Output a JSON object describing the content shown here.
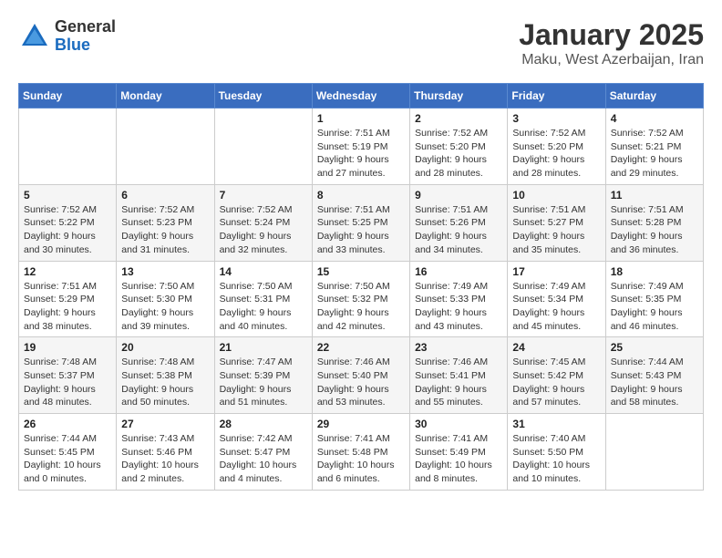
{
  "header": {
    "logo_general": "General",
    "logo_blue": "Blue",
    "title": "January 2025",
    "subtitle": "Maku, West Azerbaijan, Iran"
  },
  "weekdays": [
    "Sunday",
    "Monday",
    "Tuesday",
    "Wednesday",
    "Thursday",
    "Friday",
    "Saturday"
  ],
  "weeks": [
    [
      {
        "day": "",
        "detail": ""
      },
      {
        "day": "",
        "detail": ""
      },
      {
        "day": "",
        "detail": ""
      },
      {
        "day": "1",
        "detail": "Sunrise: 7:51 AM\nSunset: 5:19 PM\nDaylight: 9 hours\nand 27 minutes."
      },
      {
        "day": "2",
        "detail": "Sunrise: 7:52 AM\nSunset: 5:20 PM\nDaylight: 9 hours\nand 28 minutes."
      },
      {
        "day": "3",
        "detail": "Sunrise: 7:52 AM\nSunset: 5:20 PM\nDaylight: 9 hours\nand 28 minutes."
      },
      {
        "day": "4",
        "detail": "Sunrise: 7:52 AM\nSunset: 5:21 PM\nDaylight: 9 hours\nand 29 minutes."
      }
    ],
    [
      {
        "day": "5",
        "detail": "Sunrise: 7:52 AM\nSunset: 5:22 PM\nDaylight: 9 hours\nand 30 minutes."
      },
      {
        "day": "6",
        "detail": "Sunrise: 7:52 AM\nSunset: 5:23 PM\nDaylight: 9 hours\nand 31 minutes."
      },
      {
        "day": "7",
        "detail": "Sunrise: 7:52 AM\nSunset: 5:24 PM\nDaylight: 9 hours\nand 32 minutes."
      },
      {
        "day": "8",
        "detail": "Sunrise: 7:51 AM\nSunset: 5:25 PM\nDaylight: 9 hours\nand 33 minutes."
      },
      {
        "day": "9",
        "detail": "Sunrise: 7:51 AM\nSunset: 5:26 PM\nDaylight: 9 hours\nand 34 minutes."
      },
      {
        "day": "10",
        "detail": "Sunrise: 7:51 AM\nSunset: 5:27 PM\nDaylight: 9 hours\nand 35 minutes."
      },
      {
        "day": "11",
        "detail": "Sunrise: 7:51 AM\nSunset: 5:28 PM\nDaylight: 9 hours\nand 36 minutes."
      }
    ],
    [
      {
        "day": "12",
        "detail": "Sunrise: 7:51 AM\nSunset: 5:29 PM\nDaylight: 9 hours\nand 38 minutes."
      },
      {
        "day": "13",
        "detail": "Sunrise: 7:50 AM\nSunset: 5:30 PM\nDaylight: 9 hours\nand 39 minutes."
      },
      {
        "day": "14",
        "detail": "Sunrise: 7:50 AM\nSunset: 5:31 PM\nDaylight: 9 hours\nand 40 minutes."
      },
      {
        "day": "15",
        "detail": "Sunrise: 7:50 AM\nSunset: 5:32 PM\nDaylight: 9 hours\nand 42 minutes."
      },
      {
        "day": "16",
        "detail": "Sunrise: 7:49 AM\nSunset: 5:33 PM\nDaylight: 9 hours\nand 43 minutes."
      },
      {
        "day": "17",
        "detail": "Sunrise: 7:49 AM\nSunset: 5:34 PM\nDaylight: 9 hours\nand 45 minutes."
      },
      {
        "day": "18",
        "detail": "Sunrise: 7:49 AM\nSunset: 5:35 PM\nDaylight: 9 hours\nand 46 minutes."
      }
    ],
    [
      {
        "day": "19",
        "detail": "Sunrise: 7:48 AM\nSunset: 5:37 PM\nDaylight: 9 hours\nand 48 minutes."
      },
      {
        "day": "20",
        "detail": "Sunrise: 7:48 AM\nSunset: 5:38 PM\nDaylight: 9 hours\nand 50 minutes."
      },
      {
        "day": "21",
        "detail": "Sunrise: 7:47 AM\nSunset: 5:39 PM\nDaylight: 9 hours\nand 51 minutes."
      },
      {
        "day": "22",
        "detail": "Sunrise: 7:46 AM\nSunset: 5:40 PM\nDaylight: 9 hours\nand 53 minutes."
      },
      {
        "day": "23",
        "detail": "Sunrise: 7:46 AM\nSunset: 5:41 PM\nDaylight: 9 hours\nand 55 minutes."
      },
      {
        "day": "24",
        "detail": "Sunrise: 7:45 AM\nSunset: 5:42 PM\nDaylight: 9 hours\nand 57 minutes."
      },
      {
        "day": "25",
        "detail": "Sunrise: 7:44 AM\nSunset: 5:43 PM\nDaylight: 9 hours\nand 58 minutes."
      }
    ],
    [
      {
        "day": "26",
        "detail": "Sunrise: 7:44 AM\nSunset: 5:45 PM\nDaylight: 10 hours\nand 0 minutes."
      },
      {
        "day": "27",
        "detail": "Sunrise: 7:43 AM\nSunset: 5:46 PM\nDaylight: 10 hours\nand 2 minutes."
      },
      {
        "day": "28",
        "detail": "Sunrise: 7:42 AM\nSunset: 5:47 PM\nDaylight: 10 hours\nand 4 minutes."
      },
      {
        "day": "29",
        "detail": "Sunrise: 7:41 AM\nSunset: 5:48 PM\nDaylight: 10 hours\nand 6 minutes."
      },
      {
        "day": "30",
        "detail": "Sunrise: 7:41 AM\nSunset: 5:49 PM\nDaylight: 10 hours\nand 8 minutes."
      },
      {
        "day": "31",
        "detail": "Sunrise: 7:40 AM\nSunset: 5:50 PM\nDaylight: 10 hours\nand 10 minutes."
      },
      {
        "day": "",
        "detail": ""
      }
    ]
  ]
}
